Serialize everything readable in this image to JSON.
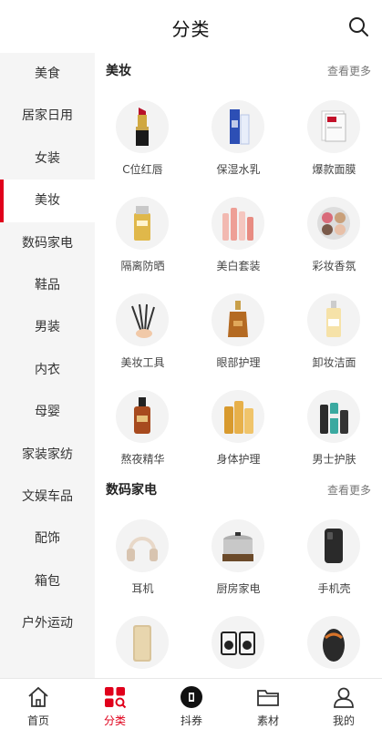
{
  "header": {
    "title": "分类"
  },
  "sidebar": {
    "items": [
      {
        "label": "美食"
      },
      {
        "label": "居家日用"
      },
      {
        "label": "女装"
      },
      {
        "label": "美妆"
      },
      {
        "label": "数码家电"
      },
      {
        "label": "鞋品"
      },
      {
        "label": "男装"
      },
      {
        "label": "内衣"
      },
      {
        "label": "母婴"
      },
      {
        "label": "家装家纺"
      },
      {
        "label": "文娱车品"
      },
      {
        "label": "配饰"
      },
      {
        "label": "箱包"
      },
      {
        "label": "户外运动"
      }
    ],
    "active_label": "美妆"
  },
  "sections": [
    {
      "title": "美妆",
      "more": "查看更多",
      "items": [
        {
          "label": "C位红唇",
          "icon": "lipstick-icon"
        },
        {
          "label": "保湿水乳",
          "icon": "lotion-bottle-icon"
        },
        {
          "label": "爆款面膜",
          "icon": "face-mask-icon"
        },
        {
          "label": "隔离防晒",
          "icon": "sunscreen-icon"
        },
        {
          "label": "美白套装",
          "icon": "skincare-set-icon"
        },
        {
          "label": "彩妆香氛",
          "icon": "eyeshadow-palette-icon"
        },
        {
          "label": "美妆工具",
          "icon": "makeup-brushes-icon"
        },
        {
          "label": "眼部护理",
          "icon": "serum-dropper-icon"
        },
        {
          "label": "卸妆洁面",
          "icon": "cleanser-bottle-icon"
        },
        {
          "label": "熬夜精华",
          "icon": "essence-bottle-icon"
        },
        {
          "label": "身体护理",
          "icon": "body-care-bottles-icon"
        },
        {
          "label": "男士护肤",
          "icon": "mens-skincare-icon"
        }
      ]
    },
    {
      "title": "数码家电",
      "more": "查看更多",
      "items": [
        {
          "label": "耳机",
          "icon": "headphones-icon"
        },
        {
          "label": "厨房家电",
          "icon": "cooking-pot-icon"
        },
        {
          "label": "手机壳",
          "icon": "phone-case-icon"
        },
        {
          "label": "",
          "icon": "power-bank-icon"
        },
        {
          "label": "",
          "icon": "speakers-icon"
        },
        {
          "label": "",
          "icon": "gaming-mouse-icon"
        }
      ]
    }
  ],
  "tabbar": {
    "items": [
      {
        "label": "首页",
        "icon": "home-icon"
      },
      {
        "label": "分类",
        "icon": "category-icon"
      },
      {
        "label": "抖券",
        "icon": "coupon-icon"
      },
      {
        "label": "素材",
        "icon": "folder-icon"
      },
      {
        "label": "我的",
        "icon": "user-icon"
      }
    ],
    "active_label": "分类",
    "accent_color": "#e0001b"
  }
}
